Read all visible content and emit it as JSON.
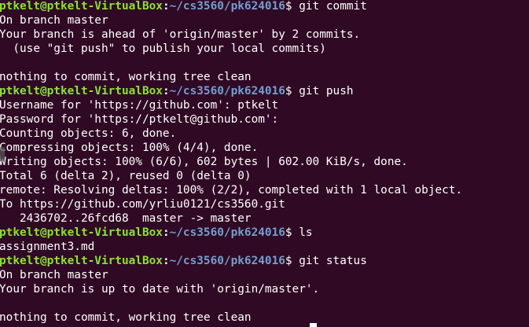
{
  "colors": {
    "background": "#300a24",
    "text": "#ffffff",
    "user_host": "#8ae234",
    "path": "#729fcf"
  },
  "terminal": {
    "lines": [
      {
        "type": "prompt",
        "user": "ptkelt@ptkelt-VirtualBox",
        "sep": ":",
        "path": "~/cs3560/pk624016",
        "symbol": "$",
        "command": " git commit"
      },
      {
        "type": "output",
        "text": "On branch master"
      },
      {
        "type": "output",
        "text": "Your branch is ahead of 'origin/master' by 2 commits."
      },
      {
        "type": "output",
        "text": "  (use \"git push\" to publish your local commits)"
      },
      {
        "type": "output",
        "text": ""
      },
      {
        "type": "output",
        "text": "nothing to commit, working tree clean"
      },
      {
        "type": "prompt",
        "user": "ptkelt@ptkelt-VirtualBox",
        "sep": ":",
        "path": "~/cs3560/pk624016",
        "symbol": "$",
        "command": " git push"
      },
      {
        "type": "output",
        "text": "Username for 'https://github.com': ptkelt"
      },
      {
        "type": "output",
        "text": "Password for 'https://ptkelt@github.com':"
      },
      {
        "type": "output",
        "text": "Counting objects: 6, done."
      },
      {
        "type": "output",
        "text": "Compressing objects: 100% (4/4), done."
      },
      {
        "type": "output",
        "text": "Writing objects: 100% (6/6), 602 bytes | 602.00 KiB/s, done."
      },
      {
        "type": "output",
        "text": "Total 6 (delta 2), reused 0 (delta 0)"
      },
      {
        "type": "output",
        "text": "remote: Resolving deltas: 100% (2/2), completed with 1 local object."
      },
      {
        "type": "output",
        "text": "To https://github.com/yrliu0121/cs3560.git"
      },
      {
        "type": "output",
        "text": "   2436702..26fcd68  master -> master"
      },
      {
        "type": "prompt",
        "user": "ptkelt@ptkelt-VirtualBox",
        "sep": ":",
        "path": "~/cs3560/pk624016",
        "symbol": "$",
        "command": " ls"
      },
      {
        "type": "output",
        "text": "assignment3.md"
      },
      {
        "type": "prompt",
        "user": "ptkelt@ptkelt-VirtualBox",
        "sep": ":",
        "path": "~/cs3560/pk624016",
        "symbol": "$",
        "command": " git status"
      },
      {
        "type": "output",
        "text": "On branch master"
      },
      {
        "type": "output",
        "text": "Your branch is up to date with 'origin/master'."
      },
      {
        "type": "output",
        "text": ""
      },
      {
        "type": "output",
        "text": "nothing to commit, working tree clean"
      }
    ]
  }
}
